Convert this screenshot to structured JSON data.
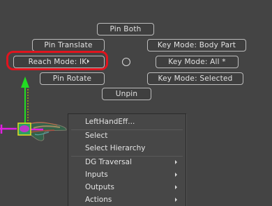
{
  "marking_menu": {
    "pin_both": "Pin Both",
    "pin_translate": "Pin Translate",
    "key_mode_body_part": "Key Mode: Body Part",
    "reach_mode": "Reach Mode: IK",
    "key_mode_all": "Key Mode: All *",
    "pin_rotate": "Pin Rotate",
    "key_mode_selected": "Key Mode: Selected",
    "unpin": "Unpin"
  },
  "context_menu": {
    "title": "LeftHandEff...",
    "items": [
      {
        "label": "Select",
        "submenu": false
      },
      {
        "label": "Select Hierarchy",
        "submenu": false
      },
      {
        "label": "DG Traversal",
        "submenu": true
      },
      {
        "label": "Inputs",
        "submenu": true
      },
      {
        "label": "Outputs",
        "submenu": true
      },
      {
        "label": "Actions",
        "submenu": true
      }
    ]
  },
  "colors": {
    "viewport_bg": "#444444",
    "highlight_ring": "#e0141e",
    "manipulator_y_axis": "#22dd22",
    "effector_selected": "#e020e0"
  },
  "icons": {
    "submenu_arrow": "triangle-right",
    "center_marker": "circle-outline",
    "translate_handle": "arrow-up"
  }
}
